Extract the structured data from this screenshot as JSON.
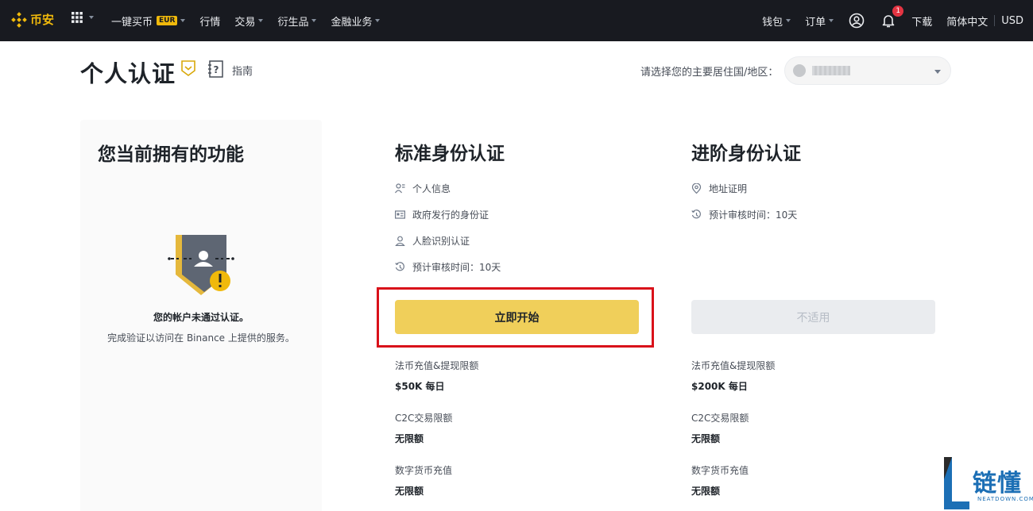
{
  "nav": {
    "logo_text": "币安",
    "items": [
      {
        "label": "一键买币",
        "badge": "EUR",
        "has_caret": true
      },
      {
        "label": "行情",
        "has_caret": false
      },
      {
        "label": "交易",
        "has_caret": true
      },
      {
        "label": "衍生品",
        "has_caret": true
      },
      {
        "label": "金融业务",
        "has_caret": true
      }
    ],
    "right": {
      "wallet": "钱包",
      "orders": "订单",
      "notification_count": "1",
      "download": "下载",
      "language": "简体中文",
      "currency": "USD"
    }
  },
  "header": {
    "title": "个人认证",
    "guide_label": "指南",
    "country_label": "请选择您的主要居住国/地区："
  },
  "current": {
    "title": "您当前拥有的功能",
    "status_title": "您的帐户未通过认证。",
    "status_desc": "完成验证以访问在 Binance 上提供的服务。"
  },
  "standard": {
    "title": "标准身份认证",
    "requirements": [
      "个人信息",
      "政府发行的身份证",
      "人脸识别认证",
      "预计审核时间：10天"
    ],
    "button": "立即开始",
    "limits": [
      {
        "label": "法币充值&提现限额",
        "value": "$50K 每日"
      },
      {
        "label": "C2C交易限额",
        "value": "无限额"
      },
      {
        "label": "数字货币充值",
        "value": "无限额"
      }
    ]
  },
  "advanced": {
    "title": "进阶身份认证",
    "requirements": [
      "地址证明",
      "预计审核时间：10天"
    ],
    "button": "不适用",
    "limits": [
      {
        "label": "法币充值&提现限额",
        "value": "$200K 每日"
      },
      {
        "label": "C2C交易限额",
        "value": "无限额"
      },
      {
        "label": "数字货币充值",
        "value": "无限额"
      }
    ]
  },
  "watermark": {
    "text": "链懂",
    "sub": "NEATDOWN.COM"
  },
  "colors": {
    "brand": "#f0b90b",
    "primary_button": "#f0cf5a",
    "highlight_box": "#d9111a",
    "topbar": "#181a20"
  }
}
